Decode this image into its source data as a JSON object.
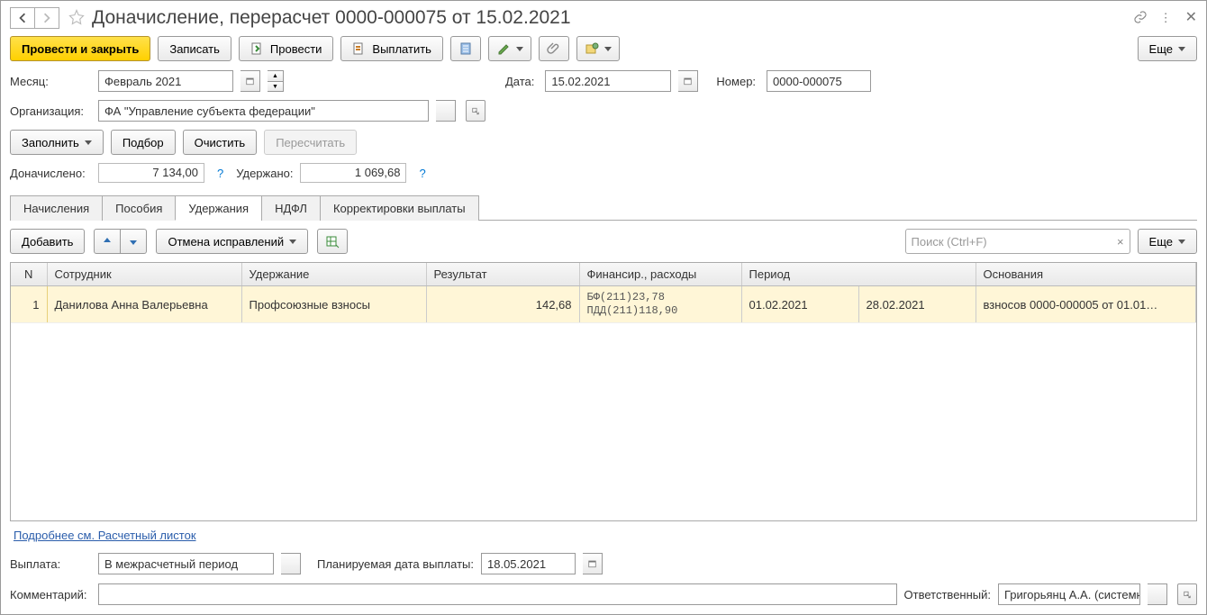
{
  "title": "Доначисление, перерасчет 0000-000075 от 15.02.2021",
  "toolbar": {
    "post_close": "Провести и закрыть",
    "save": "Записать",
    "post": "Провести",
    "pay": "Выплатить",
    "more": "Еще"
  },
  "fields": {
    "month_label": "Месяц:",
    "month_value": "Февраль 2021",
    "date_label": "Дата:",
    "date_value": "15.02.2021",
    "number_label": "Номер:",
    "number_value": "0000-000075",
    "org_label": "Организация:",
    "org_value": "ФА \"Управление субъекта федерации\"",
    "fill": "Заполнить",
    "pick": "Подбор",
    "clear": "Очистить",
    "recalc": "Пересчитать",
    "donach_label": "Доначислено:",
    "donach_value": "7 134,00",
    "uderz_label": "Удержано:",
    "uderz_value": "1 069,68"
  },
  "tabs": {
    "accruals": "Начисления",
    "benefits": "Пособия",
    "deductions": "Удержания",
    "ndfl": "НДФЛ",
    "corr": "Корректировки выплаты"
  },
  "tab_toolbar": {
    "add": "Добавить",
    "cancel_fix": "Отмена исправлений",
    "search_placeholder": "Поиск (Ctrl+F)",
    "more": "Еще"
  },
  "table": {
    "cols": {
      "n": "N",
      "emp": "Сотрудник",
      "ded": "Удержание",
      "res": "Результат",
      "fin": "Финансир., расходы",
      "period": "Период",
      "base": "Основания"
    },
    "row": {
      "n": "1",
      "emp": "Данилова Анна Валерьевна",
      "ded": "Профсоюзные взносы",
      "res": "142,68",
      "fin1": "БФ(211)23,78",
      "fin2": "ПДД(211)118,90",
      "p_from": "01.02.2021",
      "p_to": "28.02.2021",
      "base": "взносов 0000-000005 от 01.01…"
    }
  },
  "footer_link": "Подробнее см. Расчетный листок",
  "bottom": {
    "pay_label": "Выплата:",
    "pay_value": "В межрасчетный период",
    "plan_label": "Планируемая дата выплаты:",
    "plan_value": "18.05.2021",
    "comment_label": "Комментарий:",
    "comment_value": "",
    "resp_label": "Ответственный:",
    "resp_value": "Григорьянц А.А. (системн"
  }
}
